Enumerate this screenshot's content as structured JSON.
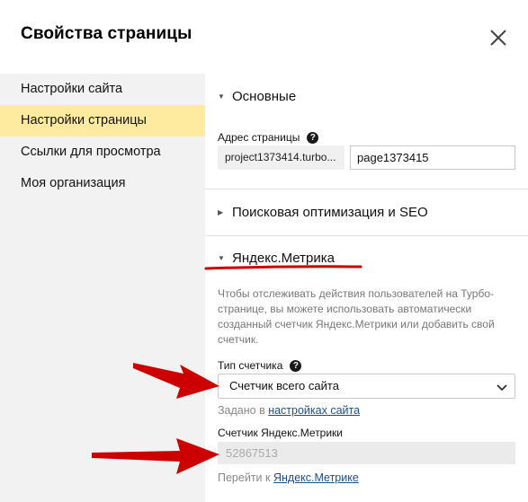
{
  "dialog": {
    "title": "Свойства страницы",
    "close_icon": "close-icon"
  },
  "sidebar": {
    "items": [
      {
        "label": "Настройки сайта",
        "active": false
      },
      {
        "label": "Настройки страницы",
        "active": true
      },
      {
        "label": "Ссылки для просмотра",
        "active": false
      },
      {
        "label": "Моя организация",
        "active": false
      }
    ]
  },
  "sections": {
    "basic": {
      "title": "Основные",
      "address_label": "Адрес страницы",
      "domain": "project1373414.turbo...",
      "page_value": "page1373415"
    },
    "seo": {
      "title": "Поисковая оптимизация и SEO"
    },
    "metrika": {
      "title": "Яндекс.Метрика",
      "description": "Чтобы отслеживать действия пользователей на Турбо-странице, вы можете использовать автоматически созданный счетчик Яндекс.Метрики или добавить свой счетчик.",
      "counter_type_label": "Тип счетчика",
      "counter_type_value": "Счетчик всего сайта",
      "set_in_prefix": "Задано в",
      "set_in_link": "настройках сайта",
      "counter_label": "Счетчик Яндекс.Метрики",
      "counter_value": "52867513",
      "goto_prefix": "Перейти к",
      "goto_link": "Яндекс.Метрике"
    }
  },
  "colors": {
    "active_bg": "#ffeba0",
    "sidebar_bg": "#f2f2f2",
    "annotation_red": "#cc0000",
    "link": "#1a4f8b"
  }
}
